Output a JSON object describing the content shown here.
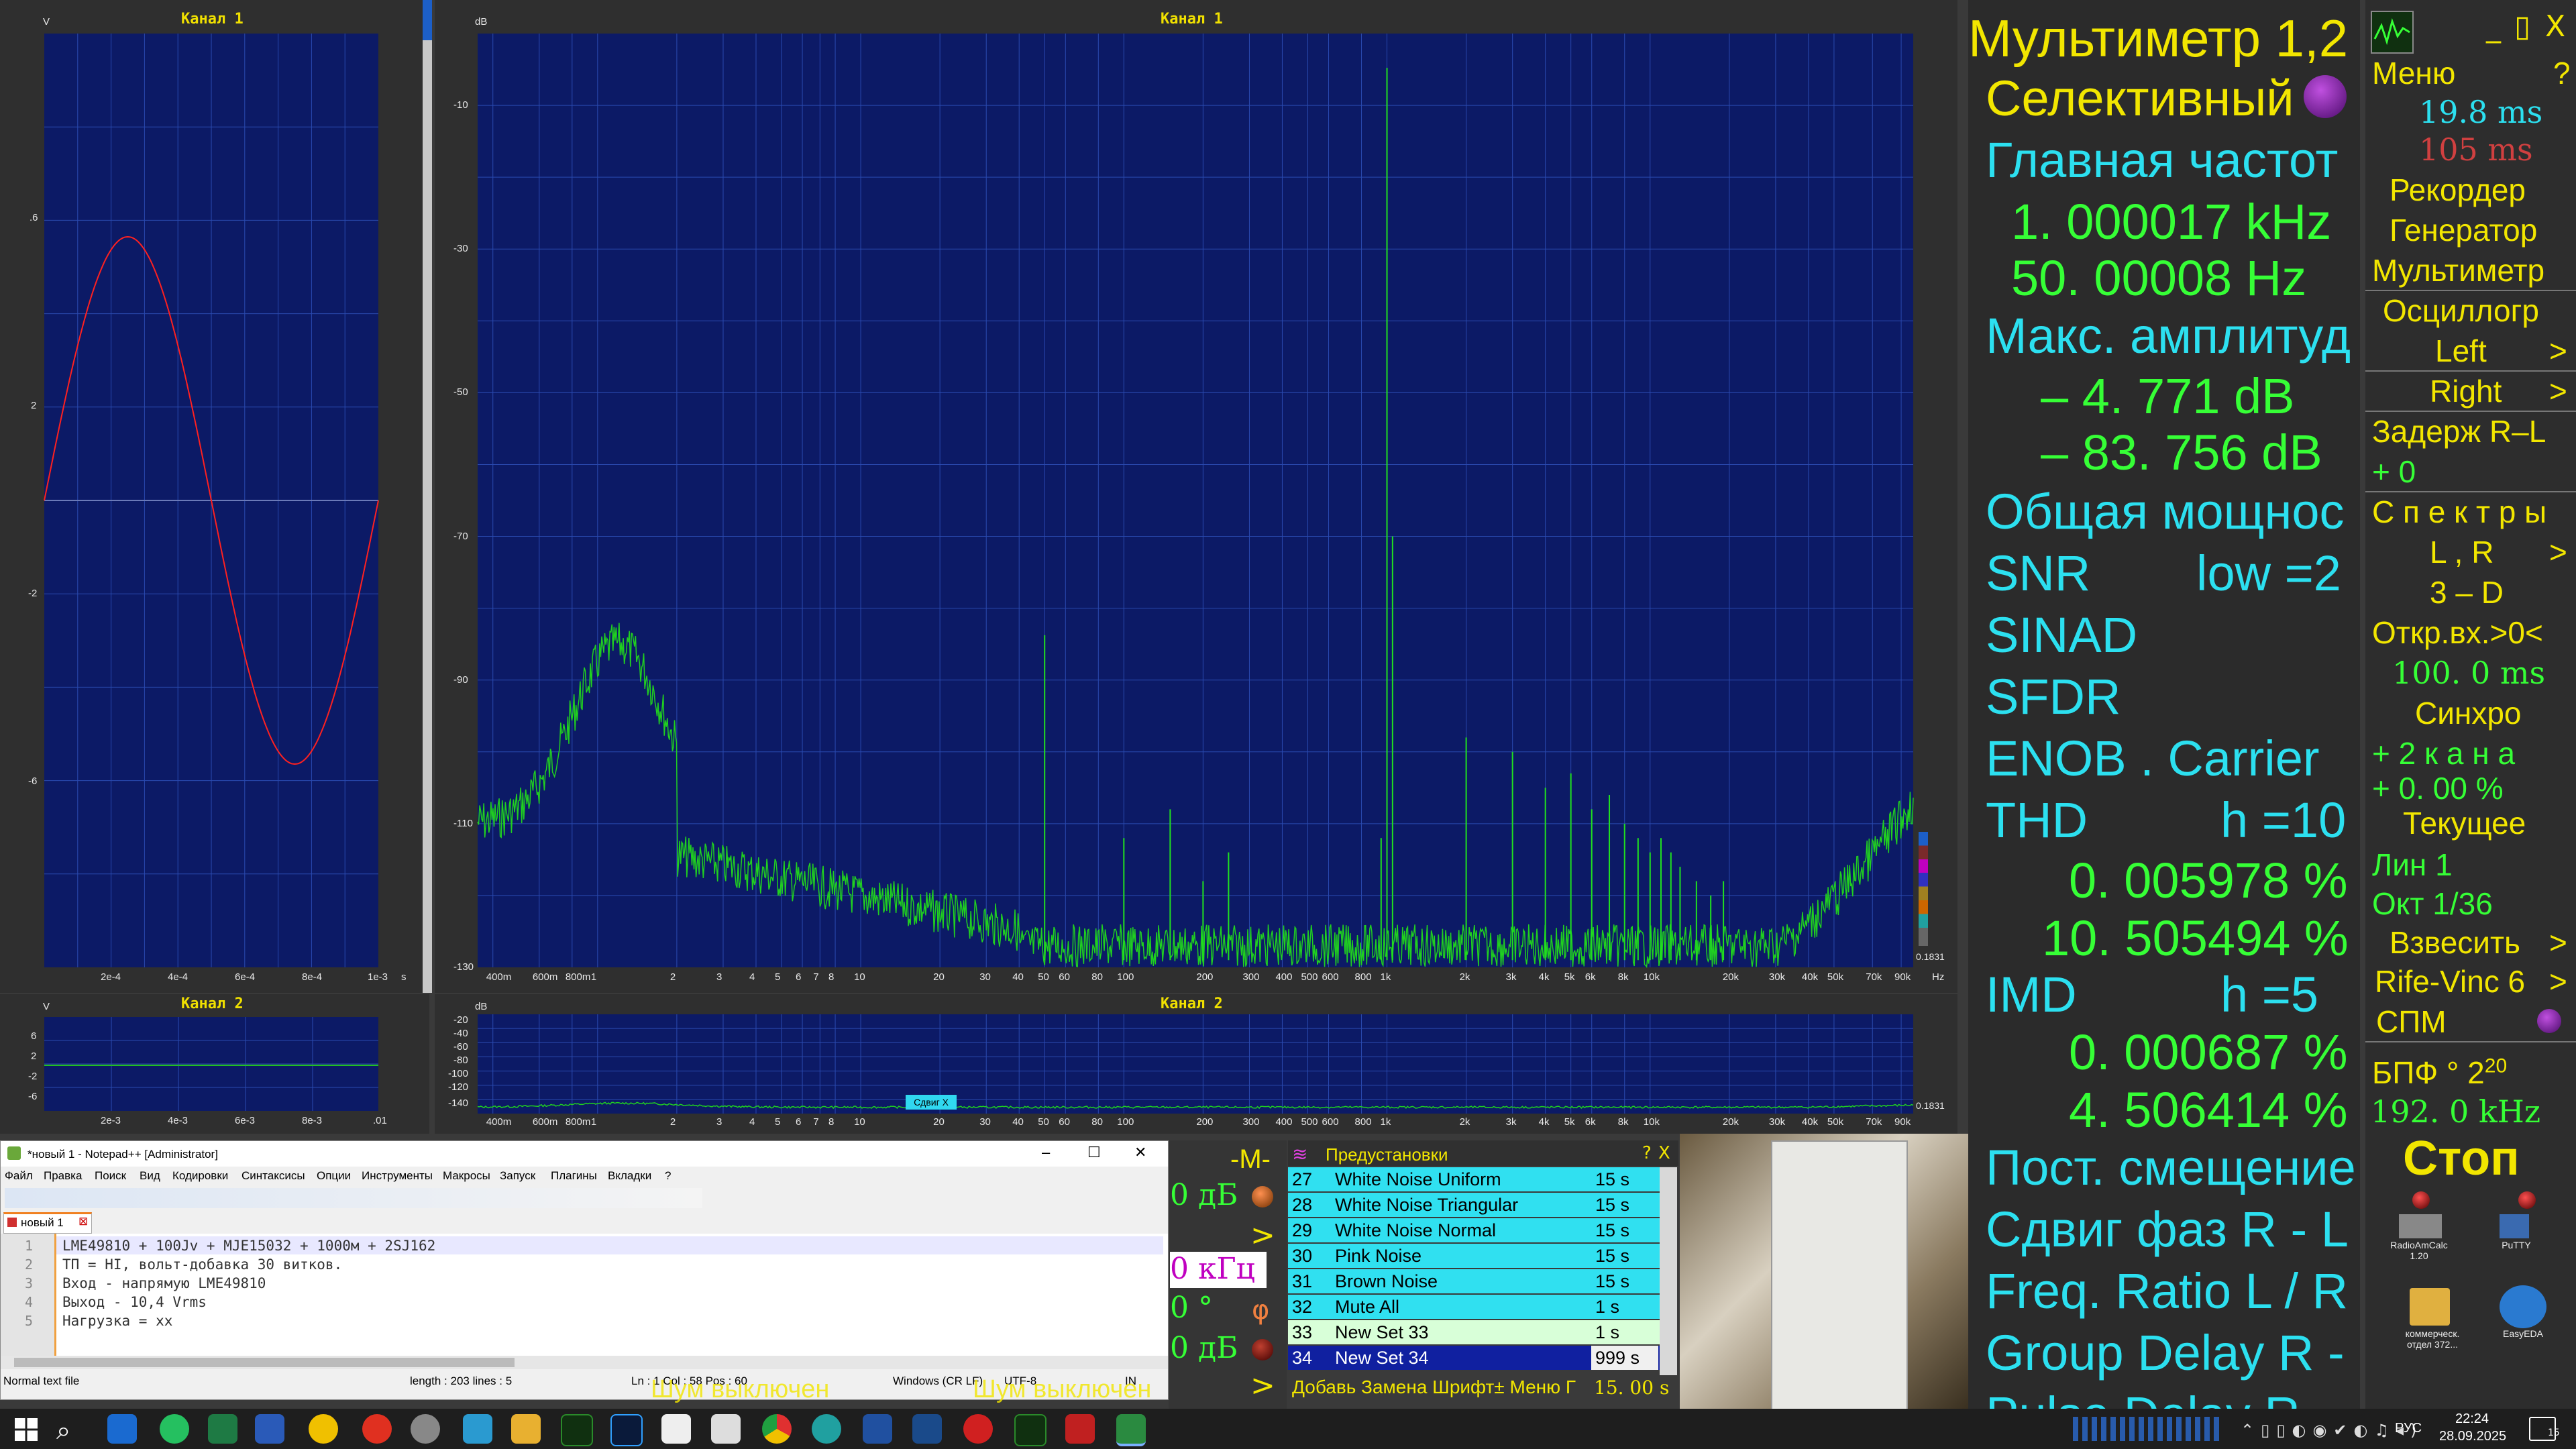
{
  "osc1": {
    "title": "Канал 1",
    "unit_y": "V",
    "unit_x": "s",
    "y_ticks": [
      ".6",
      "2",
      "-2",
      "-6"
    ],
    "x_ticks": [
      "2e-4",
      "4e-4",
      "6e-4",
      "8e-4",
      "1e-3"
    ]
  },
  "osc2": {
    "title": "Канал 2",
    "unit_y": "V",
    "unit_x": "s",
    "y_ticks": [
      "6",
      "2",
      "-2",
      "-6"
    ],
    "x_ticks": [
      "2e-3",
      "4e-3",
      "6e-3",
      "8e-3",
      ".01"
    ]
  },
  "spec1": {
    "title": "Канал 1",
    "unit_y": "dB",
    "unit_x": "Hz",
    "y_ticks": [
      "-10",
      "-30",
      "-50",
      "-70",
      "-90",
      "-110",
      "-130"
    ],
    "x_ticks": [
      "400m",
      "600m",
      "800m",
      "1",
      "2",
      "3",
      "4",
      "5",
      "6",
      "7",
      "8",
      "10",
      "20",
      "30",
      "40",
      "50",
      "60",
      "80",
      "100",
      "200",
      "300",
      "400",
      "500",
      "600",
      "800",
      "1k",
      "2k",
      "3k",
      "4k",
      "5k",
      "6k",
      "8k",
      "10k",
      "20k",
      "30k",
      "40k",
      "50k",
      "70k",
      "90k"
    ],
    "bin": "0.1831"
  },
  "spec2": {
    "title": "Канал 2",
    "unit_y": "dB",
    "unit_x": "Hz",
    "y_ticks": [
      "-20",
      "-40",
      "-60",
      "-80",
      "-100",
      "-120",
      "-140"
    ],
    "bin": "0.1831",
    "shift_btn": "Сдвиг X"
  },
  "chart_data": [
    {
      "type": "line",
      "title": "Канал 1",
      "xlabel": "s",
      "ylabel": "V",
      "x": [
        0,
        0.0001,
        0.0002,
        0.00025,
        0.0003,
        0.0004,
        0.0005,
        0.0006,
        0.0007,
        0.00075,
        0.0008,
        0.0009,
        0.001
      ],
      "y": [
        0,
        2.9,
        4.6,
        4.8,
        4.6,
        2.9,
        0,
        -2.9,
        -4.6,
        -4.8,
        -4.6,
        -2.9,
        0
      ],
      "ylim": [
        -8.5,
        8.5
      ],
      "xlim": [
        0,
        0.001
      ]
    },
    {
      "type": "line",
      "title": "Канал 1",
      "xlabel": "Hz",
      "ylabel": "dB",
      "log_x": true,
      "xlim": [
        0.35,
        100000
      ],
      "ylim": [
        -130,
        0
      ],
      "x": [
        1000,
        50,
        2000,
        3000,
        4000,
        5000,
        6000,
        7000,
        8000,
        9000,
        10000
      ],
      "y": [
        -4.771,
        -83.756,
        -98,
        -100,
        -105,
        -103,
        -108,
        -106,
        -110,
        -112,
        -114
      ]
    }
  ],
  "multimeter": {
    "title": "Мультиметр 1,2",
    "mode": "Селективный",
    "main_freq_label": "Главная частот",
    "freq1": "1. 000017 kHz",
    "freq2": "50. 00008  Hz",
    "max_amp_label": "Макс. амплитуд",
    "amp1": "–    4. 771 dB",
    "amp2": "–  83. 756 dB",
    "power_label": "Общая мощнос",
    "snr_label": "SNR",
    "snr_low": "low =2",
    "sinad_label": "SINAD",
    "sfdr_label": "SFDR",
    "enob_label": "ENOB . Carrier",
    "thd_label": "THD",
    "thd_h": "h =10",
    "thd1": "0. 005978 %",
    "thd2": "10. 505494 %",
    "imd_label": "IMD",
    "imd_h": "h =5",
    "imd1": "0. 000687 %",
    "imd2": "4. 506414 %",
    "dc_label": "Пост. смещение",
    "phase_label": "Сдвиг фаз R - L",
    "ratio_label": "Freq. Ratio  L / R",
    "gd_label": "Group Delay R -",
    "pd_label": "Pulse Delay R -"
  },
  "menu": {
    "menu": "Меню",
    "q": "?",
    "t1": "19.8 ms",
    "t2": "105  ms",
    "recorder": "Рекордер",
    "generator": "Генератор",
    "multimeter": "Мультиметр",
    "osc": "Осциллогр",
    "left": "Left",
    "right": "Right",
    "delay": "Задерж  R–L",
    "delay_v": "+        0",
    "spectra": "С п е к т р ы",
    "lr": "L , R",
    "d3": "3 – D",
    "open": "Откр.вх.>0<",
    "open_v": "100. 0 ms",
    "sync": "Синхро",
    "sync_v": "+  2  к  а  н  а",
    "pct": "+  0. 00 %",
    "current": "Текущее",
    "lin": "Лин          1",
    "okt": "Окт   1/36",
    "weigh": "Взвесить",
    "rife": "Rife-Vinc 6",
    "spm": "СПМ",
    "fft": "БПФ  °  2",
    "fft_exp": "20",
    "fs": "192. 0 kHz",
    "stop": "Стоп",
    "desk1": "RadioAmCalc 1.20",
    "desk2": "PuTTY",
    "desk3": "коммерческ. отдел 372...",
    "desk4": "EasyEDA"
  },
  "notepad": {
    "title": "*новый 1 - Notepad++ [Administrator]",
    "menus": [
      "Файл",
      "Правка",
      "Поиск",
      "Вид",
      "Кодировки",
      "Синтаксисы",
      "Опции",
      "Инструменты",
      "Макросы",
      "Запуск",
      "Плагины",
      "Вкладки",
      "?"
    ],
    "tab": "новый 1",
    "lines": [
      "LME49810 + 100Jv + MJE15032 + 1000м + 2SJ162",
      "ТП = HI, вольт-добавка 30 витков.",
      "Вход - напрямую LME49810",
      "Выход - 10,4 Vrms",
      "Нагрузка = xx"
    ],
    "status": {
      "type": "Normal text file",
      "length": "length : 203   lines : 5",
      "pos": "Ln : 1    Col : 58    Pos : 60",
      "eol": "Windows (CR LF)",
      "enc": "UTF-8",
      "ins": "IN"
    }
  },
  "gen": {
    "m": "-M-",
    "db1": "0 дБ",
    "khz": "0 кГц",
    "deg": "0 °",
    "db2": "0 дБ",
    "phi": "φ",
    "noise": "Шум выключен",
    "noise2": "Шум выключен"
  },
  "presets": {
    "title": "Предустановки",
    "q": "?",
    "rows": [
      {
        "n": "27",
        "name": "White Noise Uniform",
        "t": "15 s"
      },
      {
        "n": "28",
        "name": "White Noise Triangular",
        "t": "15 s"
      },
      {
        "n": "29",
        "name": "White Noise Normal",
        "t": "15 s"
      },
      {
        "n": "30",
        "name": "Pink Noise",
        "t": "15 s"
      },
      {
        "n": "31",
        "name": "Brown Noise",
        "t": "15 s"
      },
      {
        "n": "32",
        "name": "Mute All",
        "t": "1 s"
      },
      {
        "n": "33",
        "name": "New Set 33",
        "t": "1 s"
      },
      {
        "n": "34",
        "name": "New Set 34",
        "t": "999 s"
      }
    ],
    "footer": "Добавь Замена Шрифт± Меню Г",
    "footer_v": "15. 00 s"
  },
  "taskbar": {
    "lang": "РУС",
    "time": "22:24",
    "date": "28.09.2025",
    "notif": "15"
  }
}
